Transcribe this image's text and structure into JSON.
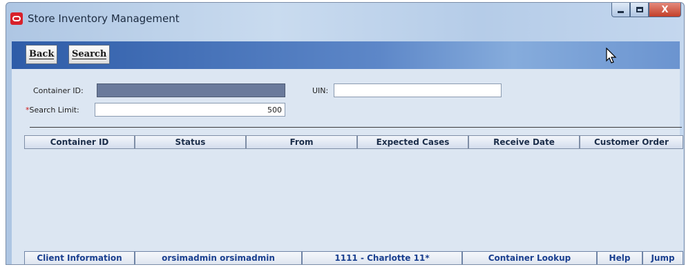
{
  "window": {
    "title": "Store Inventory Management",
    "close_glyph": "X"
  },
  "toolbar": {
    "back_label": "Back",
    "search_label": "Search"
  },
  "form": {
    "container_id_label": "Container ID:",
    "container_id_value": "",
    "uin_label": "UIN:",
    "uin_value": "",
    "search_limit_required": "*",
    "search_limit_label": "Search Limit:",
    "search_limit_value": "500"
  },
  "table": {
    "columns": [
      "Container ID",
      "Status",
      "From",
      "Expected Cases",
      "Receive Date",
      "Customer Order"
    ],
    "rows": []
  },
  "statusbar": {
    "client_information": "Client Information",
    "user": "orsimadmin orsimadmin",
    "store": "1111 - Charlotte 11*",
    "screen": "Container Lookup",
    "help": "Help",
    "jump": "Jump"
  },
  "colors": {
    "accent_red": "#d8212b",
    "toolbar_blue": "#2e5ca8",
    "content_bg": "#dce6f2",
    "status_text": "#1a3f8f"
  },
  "icons": {
    "app": "oracle-logo-icon",
    "cursor": "mouse-pointer-icon"
  }
}
